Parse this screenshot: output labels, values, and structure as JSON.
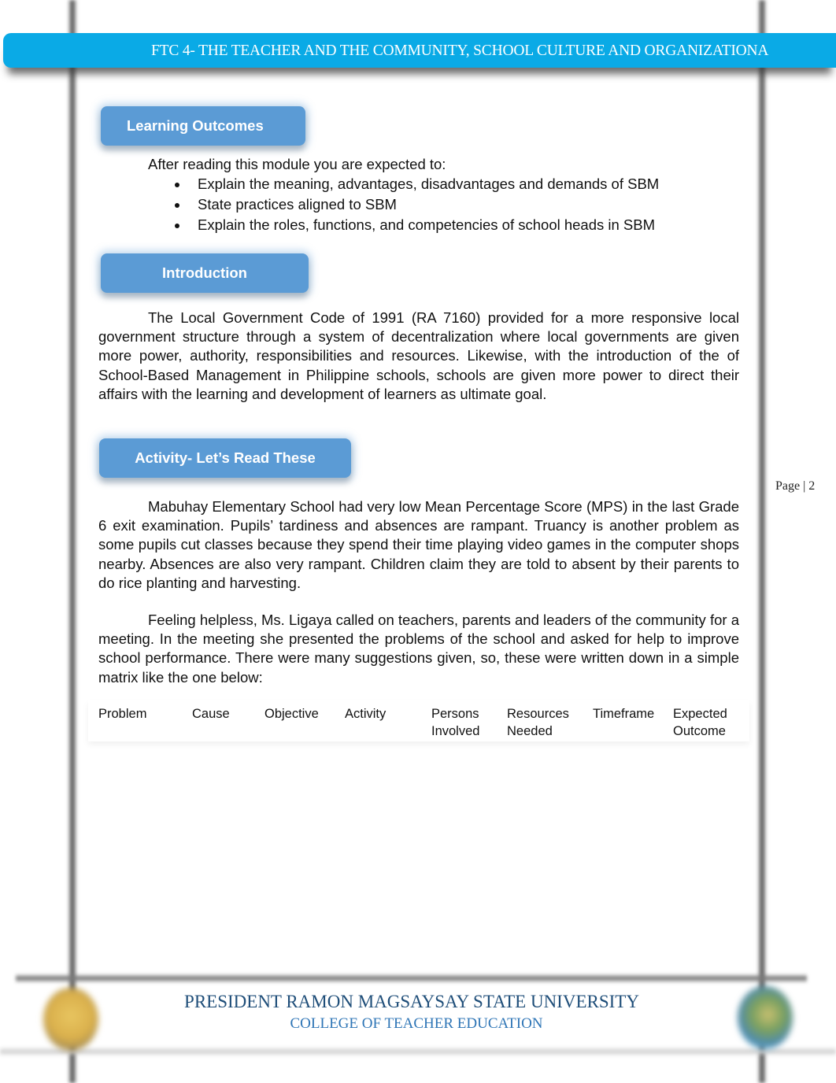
{
  "header": {
    "title": "FTC 4- THE TEACHER AND THE COMMUNITY, SCHOOL CULTURE AND ORGANIZATIONA"
  },
  "learning_outcomes": {
    "heading": "Learning Outcomes",
    "lead": "After reading this module you are expected to:",
    "bullets": [
      "Explain the meaning, advantages, disadvantages and demands of SBM",
      "State practices aligned to SBM",
      "Explain the roles, functions, and competencies of school heads in SBM"
    ]
  },
  "introduction": {
    "heading": "Introduction",
    "paragraph": "The Local Government Code of 1991 (RA 7160) provided for a more responsive local government structure through a system of decentralization where local governments are given more power, authority, responsibilities and resources. Likewise, with the introduction of the of School-Based Management in Philippine schools, schools are given more power to direct their affairs with the learning and development of learners as ultimate goal."
  },
  "activity": {
    "heading": "Activity- Let’s Read These",
    "paragraphs": [
      "Mabuhay Elementary School had very low Mean Percentage Score (MPS) in the last Grade 6 exit examination. Pupils’ tardiness and absences are rampant. Truancy is another problem as some pupils cut classes because they spend their time playing video games in the computer shops nearby. Absences are also very rampant. Children claim they are told to absent by their parents to do rice planting and harvesting.",
      "Feeling helpless, Ms. Ligaya called on teachers, parents and leaders of the community for a meeting. In the meeting she presented the problems of the school and asked for help to improve school performance. There were many suggestions given, so, these were written down in a simple matrix like the one below:"
    ],
    "matrix_columns": [
      [
        "Problem"
      ],
      [
        "Cause"
      ],
      [
        "Objective"
      ],
      [
        "Activity"
      ],
      [
        "Persons",
        "Involved"
      ],
      [
        "Resources",
        "Needed"
      ],
      [
        "Timeframe"
      ],
      [
        "Expected",
        "Outcome"
      ]
    ]
  },
  "page_number": "Page | 2",
  "footer": {
    "university": "PRESIDENT RAMON MAGSAYSAY STATE UNIVERSITY",
    "college": "COLLEGE OF TEACHER EDUCATION",
    "left_logo": "university-seal-icon",
    "right_logo": "college-seal-icon"
  },
  "colors": {
    "header_band": "#0aaae6",
    "section_pill": "#5b9bd5",
    "university_text": "#1f4e79",
    "college_text": "#2e75b6"
  }
}
